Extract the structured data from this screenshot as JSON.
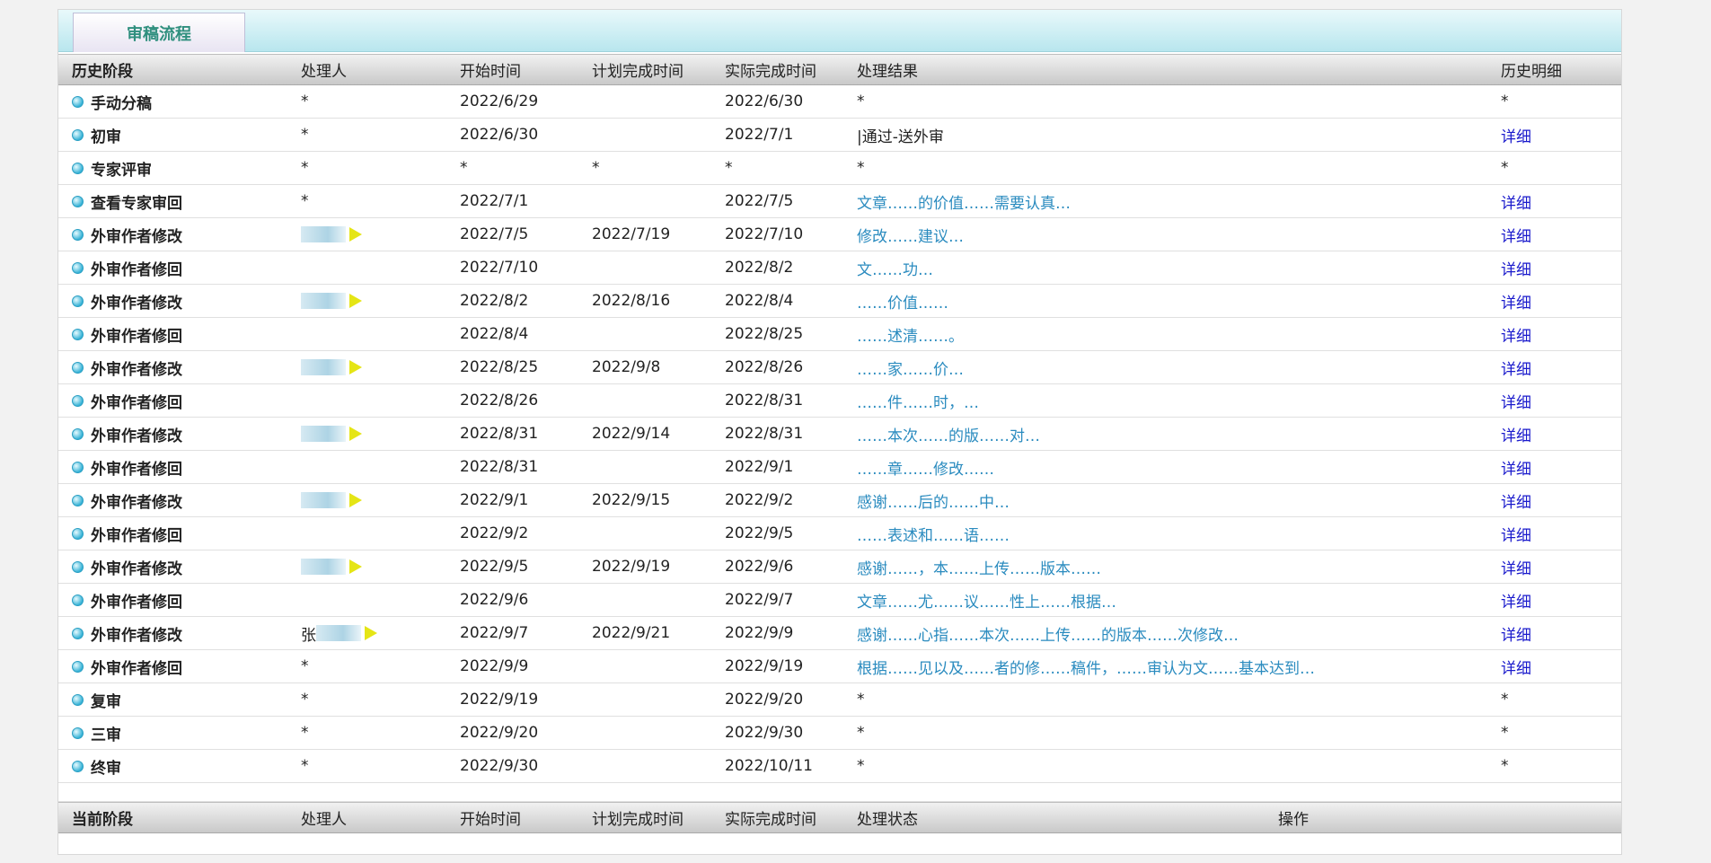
{
  "tab": {
    "label": "审稿流程"
  },
  "history_headers": [
    "历史阶段",
    "处理人",
    "开始时间",
    "计划完成时间",
    "实际完成时间",
    "处理结果",
    "历史明细"
  ],
  "history_rows": [
    {
      "stage": "手动分稿",
      "handler": "*",
      "start": "2022/6/29",
      "plan": "",
      "actual": "2022/6/30",
      "result": "*",
      "detail": "*",
      "blur": false,
      "flag": false,
      "result_link": false,
      "detail_link": false
    },
    {
      "stage": "初审",
      "handler": "*",
      "start": "2022/6/30",
      "plan": "",
      "actual": "2022/7/1",
      "result": "|通过-送外审",
      "detail": "详细",
      "blur": false,
      "flag": false,
      "result_link": false,
      "detail_link": true
    },
    {
      "stage": "专家评审",
      "handler": "*",
      "start": "*",
      "plan": "*",
      "actual": "*",
      "result": "*",
      "detail": "*",
      "blur": false,
      "flag": false,
      "result_link": false,
      "detail_link": false
    },
    {
      "stage": "查看专家审回",
      "handler": "*",
      "start": "2022/7/1",
      "plan": "",
      "actual": "2022/7/5",
      "result": "文章……的价值……需要认真…",
      "detail": "详细",
      "blur": false,
      "flag": false,
      "result_link": true,
      "detail_link": true
    },
    {
      "stage": "外审作者修改",
      "handler": "",
      "start": "2022/7/5",
      "plan": "2022/7/19",
      "actual": "2022/7/10",
      "result": "修改……建议…",
      "detail": "详细",
      "blur": true,
      "flag": true,
      "result_link": true,
      "detail_link": true
    },
    {
      "stage": "外审作者修回",
      "handler": "",
      "start": "2022/7/10",
      "plan": "",
      "actual": "2022/8/2",
      "result": "文……功…",
      "detail": "详细",
      "blur": false,
      "flag": false,
      "result_link": true,
      "detail_link": true
    },
    {
      "stage": "外审作者修改",
      "handler": "",
      "start": "2022/8/2",
      "plan": "2022/8/16",
      "actual": "2022/8/4",
      "result": "……价值……",
      "detail": "详细",
      "blur": true,
      "flag": true,
      "result_link": true,
      "detail_link": true
    },
    {
      "stage": "外审作者修回",
      "handler": "",
      "start": "2022/8/4",
      "plan": "",
      "actual": "2022/8/25",
      "result": "……述清……。",
      "detail": "详细",
      "blur": false,
      "flag": false,
      "result_link": true,
      "detail_link": true
    },
    {
      "stage": "外审作者修改",
      "handler": "",
      "start": "2022/8/25",
      "plan": "2022/9/8",
      "actual": "2022/8/26",
      "result": "……家……价…",
      "detail": "详细",
      "blur": true,
      "flag": true,
      "result_link": true,
      "detail_link": true
    },
    {
      "stage": "外审作者修回",
      "handler": "",
      "start": "2022/8/26",
      "plan": "",
      "actual": "2022/8/31",
      "result": "……件……时，…",
      "detail": "详细",
      "blur": false,
      "flag": false,
      "result_link": true,
      "detail_link": true
    },
    {
      "stage": "外审作者修改",
      "handler": "",
      "start": "2022/8/31",
      "plan": "2022/9/14",
      "actual": "2022/8/31",
      "result": "……本次……的版……对…",
      "detail": "详细",
      "blur": true,
      "flag": true,
      "result_link": true,
      "detail_link": true
    },
    {
      "stage": "外审作者修回",
      "handler": "",
      "start": "2022/8/31",
      "plan": "",
      "actual": "2022/9/1",
      "result": "……章……修改……",
      "detail": "详细",
      "blur": false,
      "flag": false,
      "result_link": true,
      "detail_link": true
    },
    {
      "stage": "外审作者修改",
      "handler": "",
      "start": "2022/9/1",
      "plan": "2022/9/15",
      "actual": "2022/9/2",
      "result": "感谢……后的……中…",
      "detail": "详细",
      "blur": true,
      "flag": true,
      "result_link": true,
      "detail_link": true
    },
    {
      "stage": "外审作者修回",
      "handler": "",
      "start": "2022/9/2",
      "plan": "",
      "actual": "2022/9/5",
      "result": "……表述和……语……",
      "detail": "详细",
      "blur": false,
      "flag": false,
      "result_link": true,
      "detail_link": true
    },
    {
      "stage": "外审作者修改",
      "handler": "",
      "start": "2022/9/5",
      "plan": "2022/9/19",
      "actual": "2022/9/6",
      "result": "感谢……，本……上传……版本……",
      "detail": "详细",
      "blur": true,
      "flag": true,
      "result_link": true,
      "detail_link": true
    },
    {
      "stage": "外审作者修回",
      "handler": "",
      "start": "2022/9/6",
      "plan": "",
      "actual": "2022/9/7",
      "result": "文章……尤……议……性上……根据…",
      "detail": "详细",
      "blur": false,
      "flag": false,
      "result_link": true,
      "detail_link": true
    },
    {
      "stage": "外审作者修改",
      "handler": "张",
      "start": "2022/9/7",
      "plan": "2022/9/21",
      "actual": "2022/9/9",
      "result": "感谢……心指……本次……上传……的版本……次修改…",
      "detail": "详细",
      "blur": true,
      "flag": true,
      "result_link": true,
      "detail_link": true
    },
    {
      "stage": "外审作者修回",
      "handler": "*",
      "start": "2022/9/9",
      "plan": "",
      "actual": "2022/9/19",
      "result": "根据……见以及……者的修……稿件，……审认为文……基本达到…",
      "detail": "详细",
      "blur": false,
      "flag": false,
      "result_link": true,
      "detail_link": true
    },
    {
      "stage": "复审",
      "handler": "*",
      "start": "2022/9/19",
      "plan": "",
      "actual": "2022/9/20",
      "result": "*",
      "detail": "*",
      "blur": false,
      "flag": false,
      "result_link": false,
      "detail_link": false
    },
    {
      "stage": "三审",
      "handler": "*",
      "start": "2022/9/20",
      "plan": "",
      "actual": "2022/9/30",
      "result": "*",
      "detail": "*",
      "blur": false,
      "flag": false,
      "result_link": false,
      "detail_link": false
    },
    {
      "stage": "终审",
      "handler": "*",
      "start": "2022/9/30",
      "plan": "",
      "actual": "2022/10/11",
      "result": "*",
      "detail": "*",
      "blur": false,
      "flag": false,
      "result_link": false,
      "detail_link": false
    }
  ],
  "current_headers": [
    "当前阶段",
    "处理人",
    "开始时间",
    "计划完成时间",
    "实际完成时间",
    "处理状态",
    "操作"
  ],
  "colors": {
    "link": "#2a8bbf",
    "detail_link": "#1a1acc",
    "dot": "#36b2d6",
    "flag": "#e5e515"
  },
  "icons": {
    "stage_marker": "circle-bullet-icon",
    "handler_flag": "yellow-flag-icon"
  }
}
